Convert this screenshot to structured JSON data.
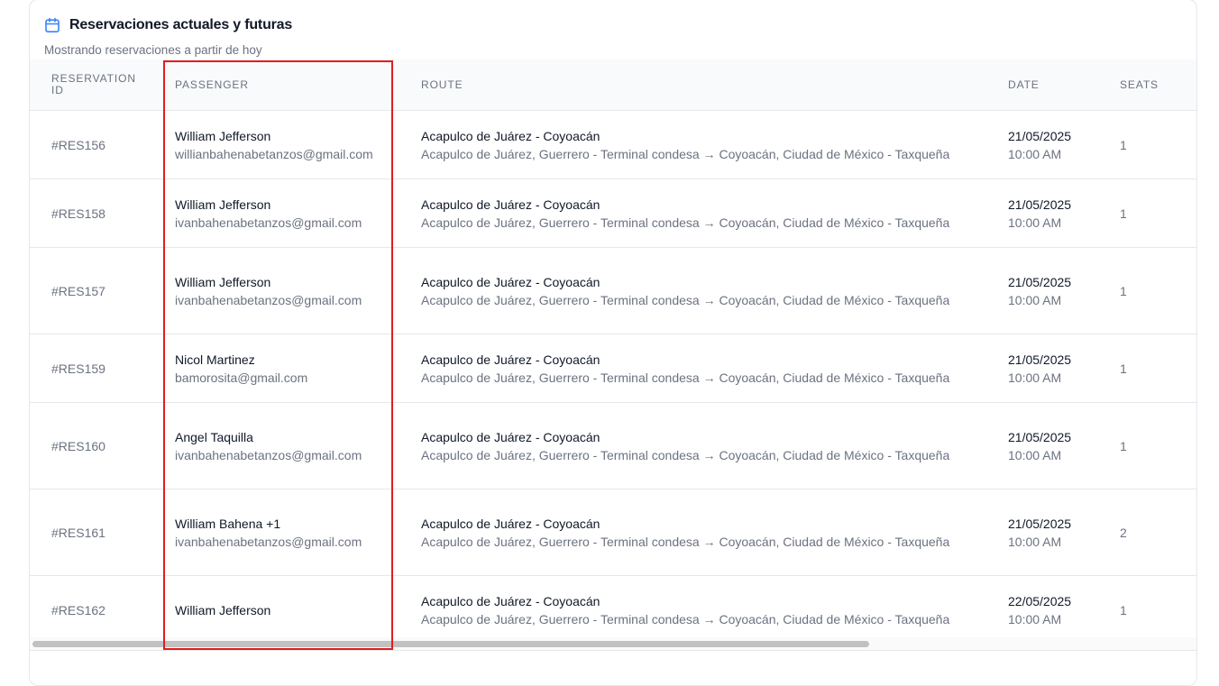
{
  "card": {
    "title": "Reservaciones actuales y futuras",
    "subtitle": "Mostrando reservaciones a partir de hoy",
    "icon": "calendar-icon",
    "accent_color": "#3b82f6"
  },
  "table": {
    "headers": {
      "id": "RESERVATION ID",
      "passenger": "PASSENGER",
      "route": "ROUTE",
      "date": "DATE",
      "seats": "SEATS"
    },
    "rows": [
      {
        "id": "#RES156",
        "name": "William Jefferson",
        "email": "willianbahenabetanzos@gmail.com",
        "route_title": "Acapulco de Juárez - Coyoacán",
        "route_detail": "Acapulco de Juárez, Guerrero - Terminal condesa → Coyoacán, Ciudad de México - Taxqueña",
        "date": "21/05/2025",
        "time": "10:00 AM",
        "seats": "1"
      },
      {
        "id": "#RES158",
        "name": "William Jefferson",
        "email": "ivanbahenabetanzos@gmail.com",
        "route_title": "Acapulco de Juárez - Coyoacán",
        "route_detail": "Acapulco de Juárez, Guerrero - Terminal condesa → Coyoacán, Ciudad de México - Taxqueña",
        "date": "21/05/2025",
        "time": "10:00 AM",
        "seats": "1"
      },
      {
        "id": "#RES157",
        "name": "William Jefferson",
        "email": "ivanbahenabetanzos@gmail.com",
        "route_title": "Acapulco de Juárez - Coyoacán",
        "route_detail": "Acapulco de Juárez, Guerrero - Terminal condesa → Coyoacán, Ciudad de México - Taxqueña",
        "date": "21/05/2025",
        "time": "10:00 AM",
        "seats": "1"
      },
      {
        "id": "#RES159",
        "name": "Nicol Martinez",
        "email": "bamorosita@gmail.com",
        "route_title": "Acapulco de Juárez - Coyoacán",
        "route_detail": "Acapulco de Juárez, Guerrero - Terminal condesa → Coyoacán, Ciudad de México - Taxqueña",
        "date": "21/05/2025",
        "time": "10:00 AM",
        "seats": "1"
      },
      {
        "id": "#RES160",
        "name": "Angel Taquilla",
        "email": "ivanbahenabetanzos@gmail.com",
        "route_title": "Acapulco de Juárez - Coyoacán",
        "route_detail": "Acapulco de Juárez, Guerrero - Terminal condesa → Coyoacán, Ciudad de México - Taxqueña",
        "date": "21/05/2025",
        "time": "10:00 AM",
        "seats": "1"
      },
      {
        "id": "#RES161",
        "name": "William Bahena +1",
        "email": "ivanbahenabetanzos@gmail.com",
        "route_title": "Acapulco de Juárez - Coyoacán",
        "route_detail": "Acapulco de Juárez, Guerrero - Terminal condesa → Coyoacán, Ciudad de México - Taxqueña",
        "date": "21/05/2025",
        "time": "10:00 AM",
        "seats": "2"
      },
      {
        "id": "#RES162",
        "name": "William Jefferson",
        "email": "",
        "route_title": "Acapulco de Juárez - Coyoacán",
        "route_detail": "Acapulco de Juárez, Guerrero - Terminal condesa → Coyoacán, Ciudad de México - Taxqueña",
        "date": "22/05/2025",
        "time": "10:00 AM",
        "seats": "1"
      }
    ]
  },
  "highlight_color": "#e11d1d"
}
